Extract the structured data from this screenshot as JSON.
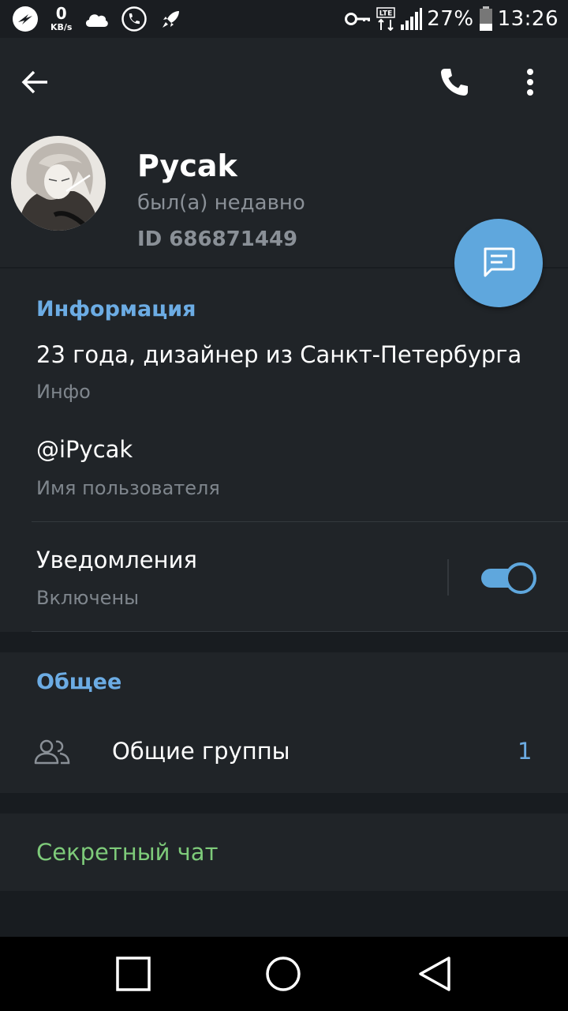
{
  "status_bar": {
    "net_speed_value": "0",
    "net_speed_unit": "KB/s",
    "network": "LTE",
    "battery": "27%",
    "time": "13:26",
    "icons": [
      "app-icon",
      "cloud-icon",
      "phone-circle-icon",
      "rocket-icon",
      "key-icon",
      "lte-icon",
      "signal-icon",
      "battery-icon"
    ]
  },
  "profile": {
    "name": "Pycak",
    "status": "был(а) недавно",
    "id": "ID 686871449"
  },
  "info": {
    "title": "Информация",
    "bio": "23 года, дизайнер из Санкт-Петербурга",
    "bio_label": "Инфо",
    "username": "@iPycak",
    "username_label": "Имя пользователя",
    "notifications": "Уведомления",
    "notifications_state": "Включены",
    "notifications_on": true
  },
  "common": {
    "title": "Общее",
    "groups_label": "Общие группы",
    "groups_count": "1"
  },
  "secret_chat": "Секретный чат",
  "colors": {
    "accent": "#6cace4",
    "fab": "#5fa7dd",
    "background": "#202428",
    "secret": "#7ecb7a"
  }
}
